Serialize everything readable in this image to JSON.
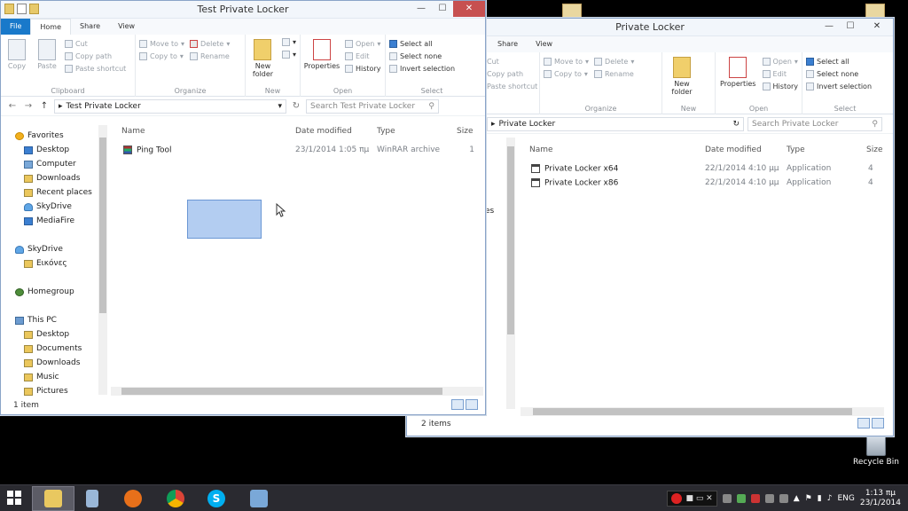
{
  "desktop": {
    "recycle_bin_label": "Recycle Bin"
  },
  "ribbon_labels": {
    "cut": "Cut",
    "copy_path": "Copy path",
    "paste_shortcut": "Paste shortcut",
    "copy": "Copy",
    "paste": "Paste",
    "clipboard": "Clipboard",
    "move_to": "Move to",
    "copy_to": "Copy to",
    "delete": "Delete",
    "rename": "Rename",
    "organize": "Organize",
    "new_folder_1": "New",
    "new_folder_2": "folder",
    "new": "New",
    "properties": "Properties",
    "open": "Open",
    "edit": "Edit",
    "history": "History",
    "open_group": "Open",
    "select_all": "Select all",
    "select_none": "Select none",
    "invert_selection": "Invert selection",
    "select": "Select"
  },
  "columns": {
    "name": "Name",
    "date_modified": "Date modified",
    "type": "Type",
    "size": "Size"
  },
  "front_window": {
    "title": "Test Private Locker",
    "tabs": [
      "File",
      "Home",
      "Share",
      "View"
    ],
    "address": "Test Private Locker",
    "search_placeholder": "Search Test Private Locker",
    "nav": {
      "favorites": "Favorites",
      "favorites_items": [
        "Desktop",
        "Computer",
        "Downloads",
        "Recent places",
        "SkyDrive",
        "MediaFire"
      ],
      "skydrive": "SkyDrive",
      "skydrive_items": [
        "Εικόνες"
      ],
      "homegroup": "Homegroup",
      "this_pc": "This PC",
      "this_pc_items": [
        "Desktop",
        "Documents",
        "Downloads",
        "Music",
        "Pictures"
      ]
    },
    "files": [
      {
        "name": "Ping Tool",
        "date": "23/1/2014 1:05 πμ",
        "type": "WinRAR archive",
        "size": "1"
      }
    ],
    "status": "1 item"
  },
  "back_window": {
    "title": "Private Locker",
    "tabs": [
      "Share",
      "View"
    ],
    "address": "Private Locker",
    "search_placeholder": "Search Private Locker",
    "partial_nav": "es",
    "files": [
      {
        "name": "Private Locker x64",
        "date": "22/1/2014 4:10 μμ",
        "type": "Application",
        "size": "4"
      },
      {
        "name": "Private Locker x86",
        "date": "22/1/2014 4:10 μμ",
        "type": "Application",
        "size": "4"
      }
    ],
    "status": "2 items"
  },
  "taskbar": {
    "language": "ENG",
    "time": "1:13 πμ",
    "date": "23/1/2014"
  },
  "colors": {
    "file_tab": "#1979ca",
    "close_button": "#c75050",
    "selection_rect": "#b3cdf1",
    "taskbar": "#2a2a30"
  }
}
